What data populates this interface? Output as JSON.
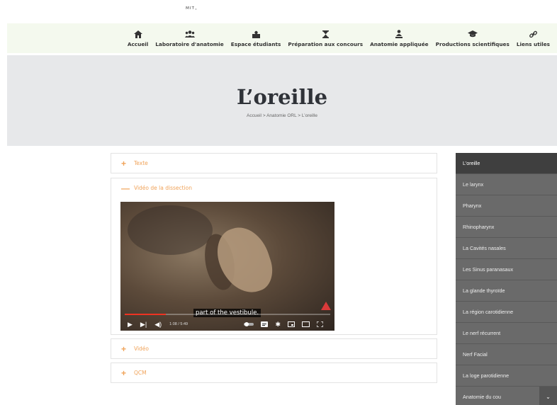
{
  "topbar": {
    "logo_fragment": "ᴹᴵᵀ·"
  },
  "nav": {
    "items": [
      {
        "label": "Accueil",
        "icon": "home-icon"
      },
      {
        "label": "Laboratoire d'anatomie",
        "icon": "users-icon"
      },
      {
        "label": "Espace étudiants",
        "icon": "students-icon"
      },
      {
        "label": "Préparation aux concours",
        "icon": "hourglass-icon"
      },
      {
        "label": "Anatomie appliquée",
        "icon": "person-icon"
      },
      {
        "label": "Productions scientifiques",
        "icon": "graduation-cap-icon"
      },
      {
        "label": "Liens utiles",
        "icon": "link-icon"
      }
    ]
  },
  "hero": {
    "title": "L’oreille",
    "breadcrumb": {
      "home": "Accueil",
      "sep1": " > ",
      "section": "Anatomie ORL",
      "sep2": " > ",
      "current": "L’oreille"
    }
  },
  "accordion": {
    "panels": [
      {
        "sign": "+",
        "title": "Texte"
      },
      {
        "sign": "—",
        "title": "Vidéo  de la dissection"
      },
      {
        "sign": "+",
        "title": "Vidéo"
      },
      {
        "sign": "+",
        "title": "QCM"
      }
    ]
  },
  "video": {
    "subtitle": "part of the vestibule.",
    "time": "1:08 / 5:49",
    "progress_fraction": 0.2
  },
  "sidebar": {
    "items": [
      {
        "label": "L’oreille",
        "active": true
      },
      {
        "label": "Le larynx"
      },
      {
        "label": "Pharynx"
      },
      {
        "label": "Rhinopharynx"
      },
      {
        "label": "La Cavités nasales"
      },
      {
        "label": "Les Sinus paranasaux"
      },
      {
        "label": "La glande thyroïde"
      },
      {
        "label": "La région carotidienne"
      },
      {
        "label": "Le nerf récurrent"
      },
      {
        "label": "Nerf Facial"
      },
      {
        "label": "La loge parotidienne"
      },
      {
        "label": "Anatomie du cou",
        "has_chevron": true
      }
    ]
  },
  "colors": {
    "accent": "#f0a35a",
    "nav_bg": "#f4f9ee",
    "hero_bg": "#e7e8ea",
    "sidebar_bg": "#6a6a6a",
    "sidebar_active": "#3f3f3f"
  }
}
